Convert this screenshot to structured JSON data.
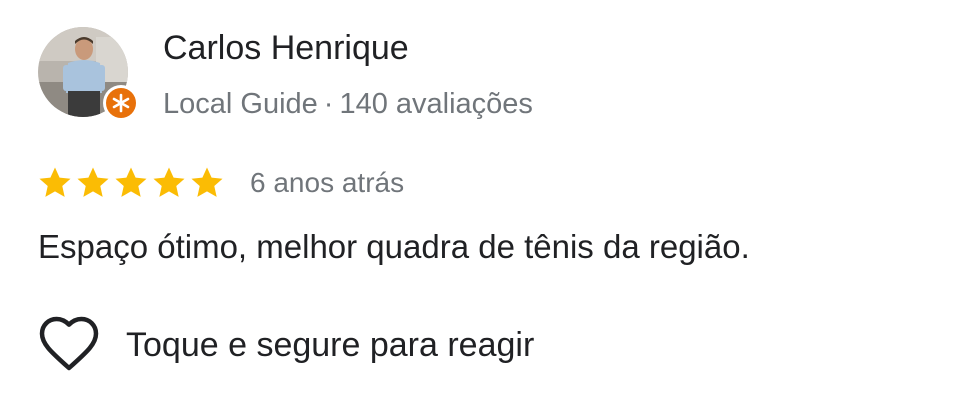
{
  "reviewer": {
    "name": "Carlos Henrique",
    "badge_label": "Local Guide",
    "separator": "·",
    "reviews_count": "140 avaliações",
    "avatar_icon": "user-photo",
    "badge_icon": "local-guide-star-badge",
    "badge_color": "#e8710a"
  },
  "review": {
    "rating": 5,
    "rating_max": 5,
    "star_color": "#fbbc04",
    "date": "6 anos atrás",
    "text": "Espaço ótimo, melhor quadra de tênis da região."
  },
  "reaction": {
    "icon": "heart-outline-icon",
    "label": "Toque e segure para reagir"
  }
}
